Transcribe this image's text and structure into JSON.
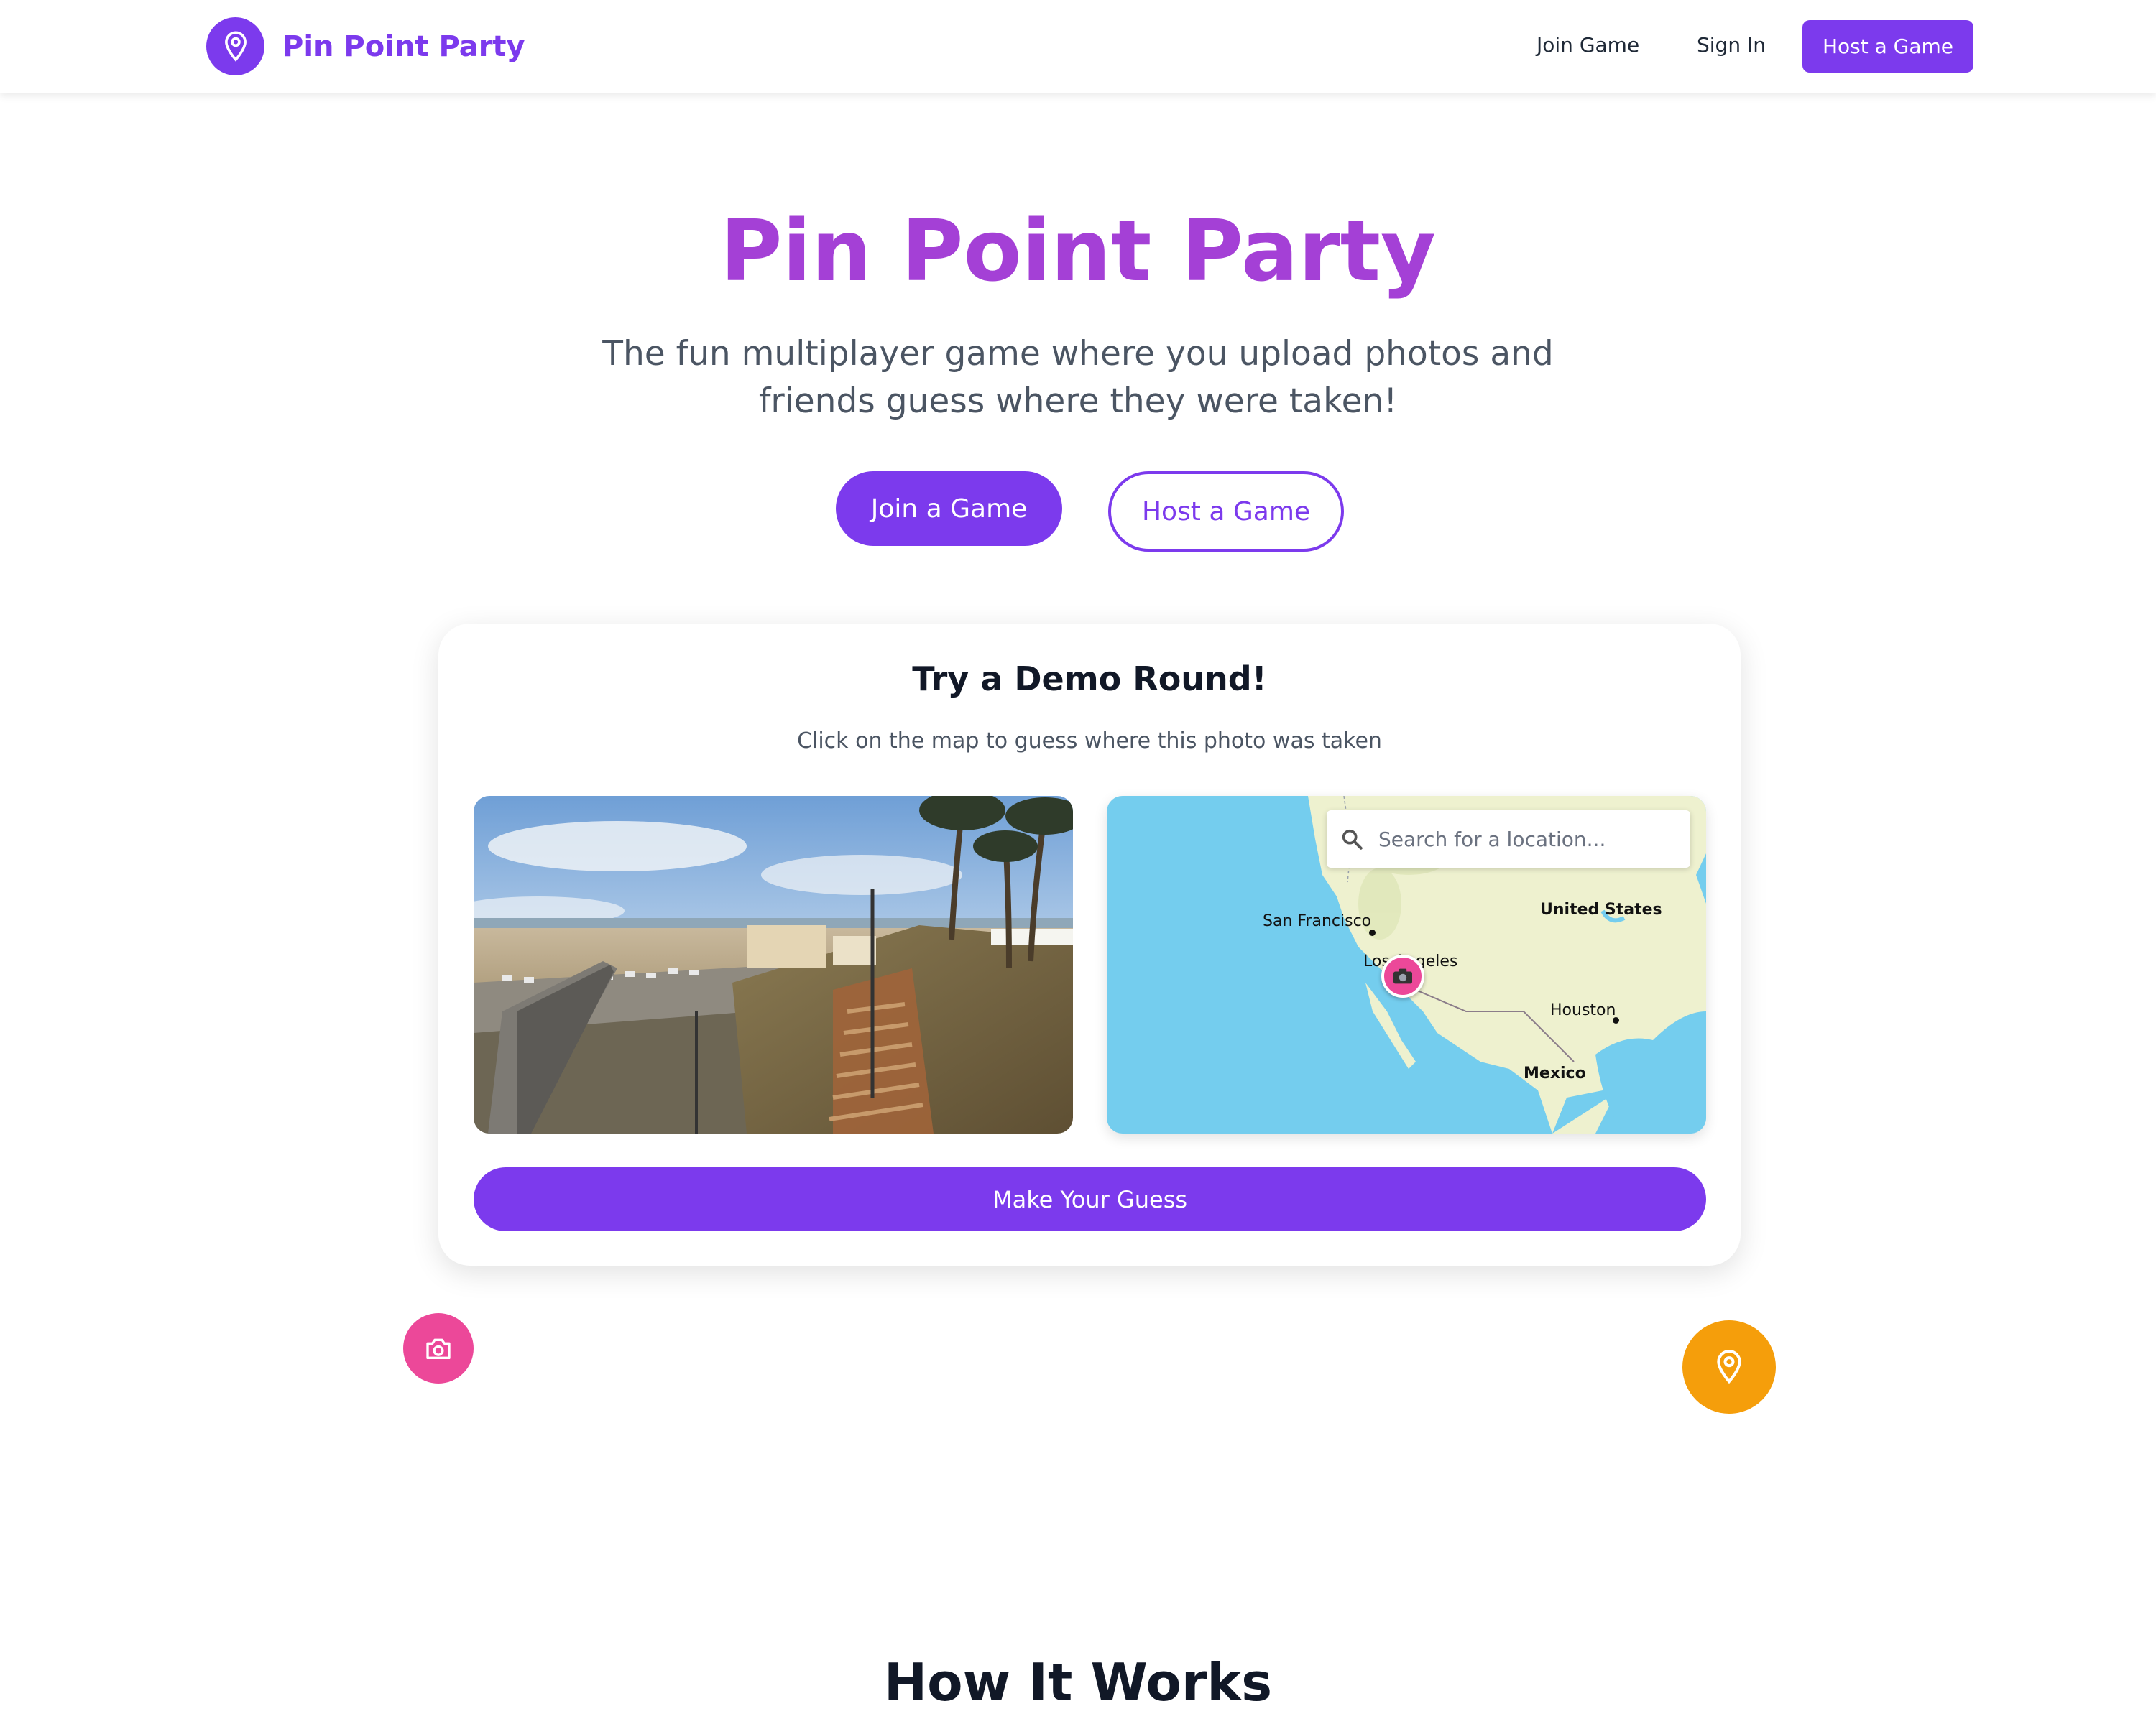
{
  "header": {
    "brand_name": "Pin Point Party",
    "brand_icon": "map-pin-icon",
    "nav": {
      "join_game": "Join Game",
      "sign_in": "Sign In",
      "host_game": "Host a Game"
    }
  },
  "hero": {
    "title": "Pin Point Party",
    "subtitle": "The fun multiplayer game where you upload photos and friends guess where they were taken!",
    "join_button": "Join a Game",
    "host_button": "Host a Game"
  },
  "demo": {
    "title": "Try a Demo Round!",
    "instructions": "Click on the map to guess where this photo was taken",
    "photo_icon": "beach-photo",
    "map": {
      "search_placeholder": "Search for a location...",
      "labels": {
        "san_francisco": "San Francisco",
        "united_states": "United States",
        "los_angeles": "Los Angeles",
        "houston": "Houston",
        "mexico": "Mexico"
      },
      "marker_icon": "camera-icon"
    },
    "guess_button": "Make Your Guess"
  },
  "floating": {
    "left_icon": "camera-icon",
    "right_icon": "map-pin-icon"
  },
  "how_it_works": {
    "title": "How It Works"
  },
  "colors": {
    "primary": "#7c3aed",
    "title_gradient_start": "#9333ea",
    "title_gradient_end": "#c13fb8",
    "pink": "#ec4899",
    "amber": "#f59e0b",
    "ocean": "#74cdee",
    "land": "#eef1cf"
  }
}
